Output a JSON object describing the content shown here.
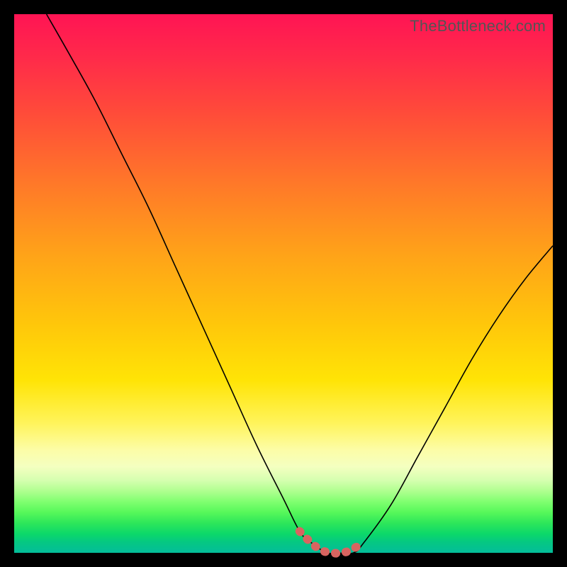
{
  "watermark": "TheBottleneck.com",
  "chart_data": {
    "type": "line",
    "title": "",
    "xlabel": "",
    "ylabel": "",
    "xlim": [
      0,
      100
    ],
    "ylim": [
      0,
      100
    ],
    "legend": false,
    "grid": false,
    "background": "rainbow-gradient",
    "series": [
      {
        "name": "bottleneck-curve",
        "color": "#000000",
        "x": [
          6,
          10,
          15,
          20,
          25,
          30,
          35,
          40,
          45,
          50,
          53,
          55,
          58,
          60,
          63,
          65,
          70,
          75,
          80,
          85,
          90,
          95,
          100
        ],
        "y": [
          100,
          93,
          84,
          74,
          64,
          53,
          42,
          31,
          20,
          10,
          4,
          2,
          0,
          0,
          0,
          2,
          9,
          18,
          27,
          36,
          44,
          51,
          57
        ]
      },
      {
        "name": "optimal-zone-highlight",
        "color": "#d86460",
        "style": "dotted-thick",
        "x": [
          53,
          55,
          57,
          59,
          61,
          63,
          65
        ],
        "y": [
          4,
          2,
          0.5,
          0,
          0,
          0.8,
          2
        ]
      }
    ],
    "annotations": []
  }
}
